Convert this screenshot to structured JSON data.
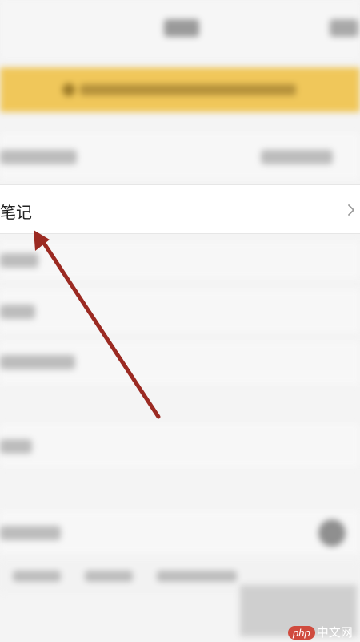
{
  "row": {
    "label": "笔记"
  },
  "watermark": {
    "brand": "php",
    "site": "中文网"
  },
  "colors": {
    "banner": "#f0c75a",
    "arrow": "#9b2a22",
    "watermark_logo": "#d04b3e"
  },
  "icons": {
    "row_chevron": "chevron-right-icon",
    "pointer": "arrow-annotation"
  }
}
